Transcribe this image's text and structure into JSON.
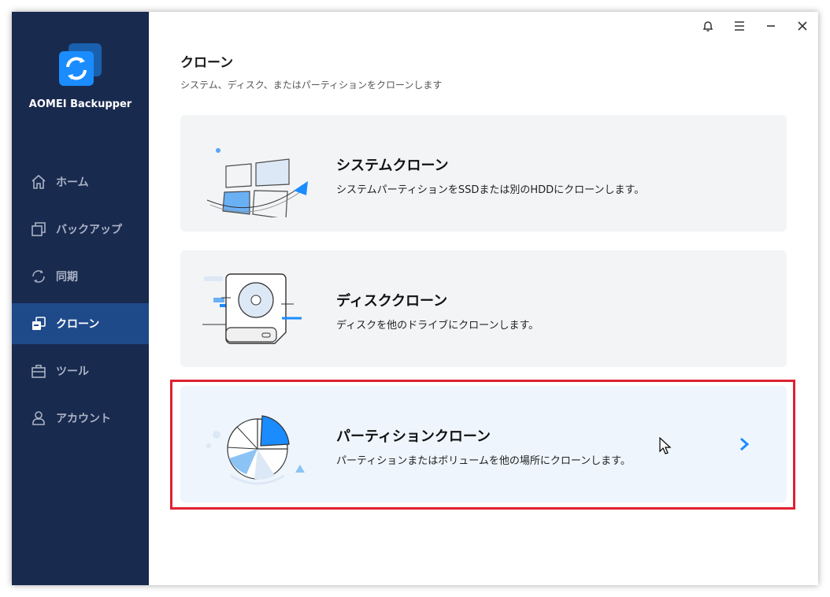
{
  "app": {
    "name": "AOMEI Backupper"
  },
  "sidebar": {
    "items": [
      {
        "label": "ホーム",
        "icon": "home-icon"
      },
      {
        "label": "バックアップ",
        "icon": "backup-icon"
      },
      {
        "label": "同期",
        "icon": "sync-icon"
      },
      {
        "label": "クローン",
        "icon": "clone-icon",
        "active": true
      },
      {
        "label": "ツール",
        "icon": "toolbox-icon"
      },
      {
        "label": "アカウント",
        "icon": "user-icon"
      }
    ]
  },
  "titlebar": {
    "icons": [
      "bell-icon",
      "menu-icon",
      "minimize-icon",
      "close-icon"
    ]
  },
  "main": {
    "title": "クローン",
    "subtitle": "システム、ディスク、またはパーティションをクローンします",
    "cards": [
      {
        "title": "システムクローン",
        "description": "システムパーティションをSSDまたは別のHDDにクローンします。"
      },
      {
        "title": "ディスククローン",
        "description": "ディスクを他のドライブにクローンします。"
      },
      {
        "title": "パーティションクローン",
        "description": "パーティションまたはボリュームを他の場所にクローンします。",
        "selected": true
      }
    ]
  },
  "colors": {
    "sidebar_bg": "#192a4f",
    "active_nav": "#1f4a8a",
    "accent": "#1a8cff",
    "highlight": "#e02130"
  }
}
